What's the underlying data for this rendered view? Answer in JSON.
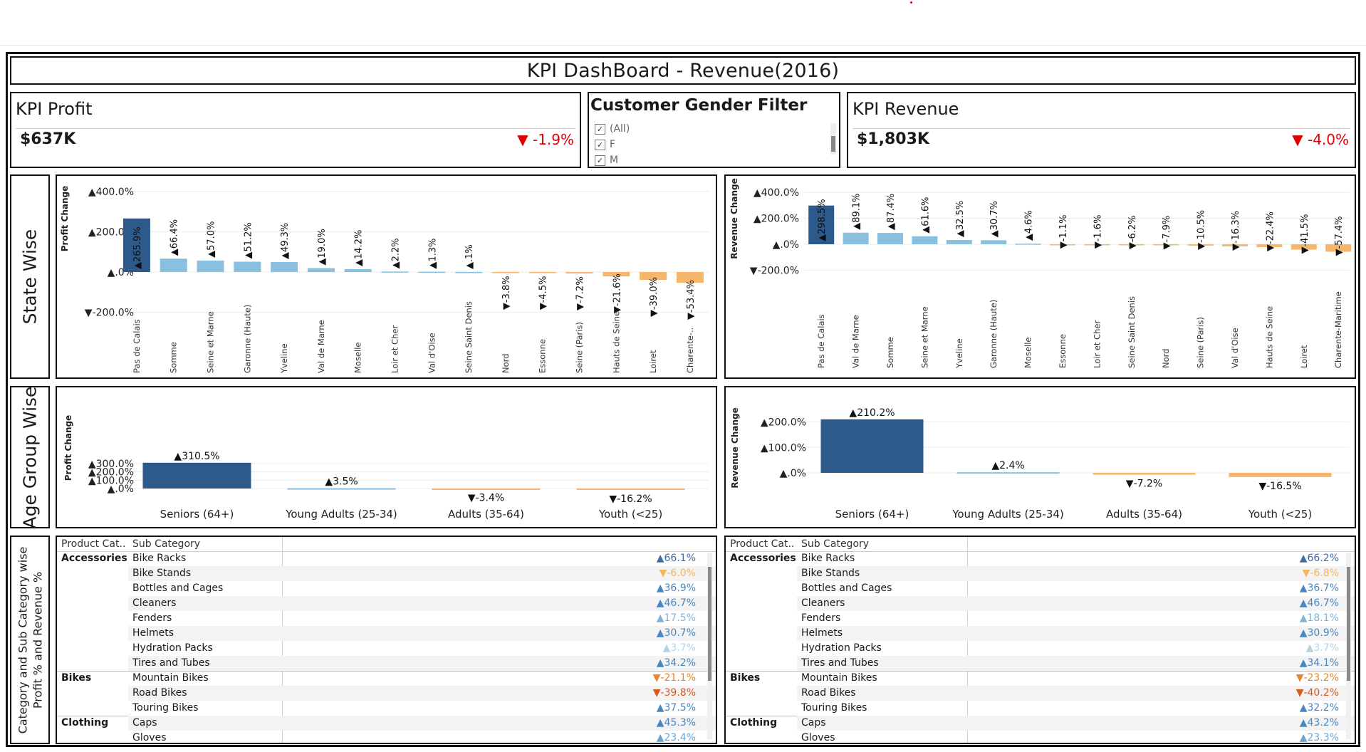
{
  "dashboard": {
    "title": "KPI DashBoard - Revenue(2016)"
  },
  "kpi_profit": {
    "title": "KPI Profit",
    "value": "$637K",
    "change": "▼ -1.9%"
  },
  "kpi_revenue": {
    "title": "KPI Revenue",
    "value": "$1,803K",
    "change": "▼ -4.0%"
  },
  "gender_filter": {
    "title": "Customer Gender Filter",
    "options": [
      {
        "label": "(All)",
        "checked": true
      },
      {
        "label": "F",
        "checked": true
      },
      {
        "label": "M",
        "checked": true
      }
    ]
  },
  "sections": {
    "state": "State Wise",
    "age": "Age Group Wise",
    "category_line1": "Category and Sub Category wise",
    "category_line2": "Profit % and Revenue %"
  },
  "colors": {
    "dark_blue": "#2c5a8a",
    "light_blue": "#89bfdf",
    "orange": "#f7b76a",
    "red": "#e00000"
  },
  "chart_data": [
    {
      "type": "bar",
      "ylabel": "Profit Change",
      "yticks": [
        "▲400.0%",
        "▲200.0%",
        "▲.0%",
        "▼-200.0%"
      ],
      "ylim": [
        -200,
        400
      ],
      "categories": [
        "Pas de Calais",
        "Somme",
        "Seine et Marne",
        "Garonne (Haute)",
        "Yveline",
        "Val de Marne",
        "Moselle",
        "Loir et Cher",
        "Val d'Oise",
        "Seine Saint Denis",
        "Nord",
        "Essonne",
        "Seine (Paris)",
        "Hauts de Seine",
        "Loiret",
        "Charente-.."
      ],
      "values": [
        265.9,
        66.4,
        57.0,
        51.2,
        49.3,
        19.0,
        14.2,
        2.2,
        1.3,
        0.1,
        -3.8,
        -4.5,
        -7.2,
        -21.6,
        -39.0,
        -53.4
      ],
      "labels": [
        "▲265.9%",
        "▲66.4%",
        "▲57.0%",
        "▲51.2%",
        "▲49.3%",
        "▲19.0%",
        "▲14.2%",
        "▲2.2%",
        "▲1.3%",
        "▲.1%",
        "▼-3.8%",
        "▼-4.5%",
        "▼-7.2%",
        "▼-21.6%",
        "▼-39.0%",
        "▼-53.4%"
      ]
    },
    {
      "type": "bar",
      "ylabel": "Revenue Change",
      "yticks": [
        "▲400.0%",
        "▲200.0%",
        "▲.0%",
        "▼-200.0%"
      ],
      "ylim": [
        -200,
        400
      ],
      "categories": [
        "Pas de Calais",
        "Val de Marne",
        "Somme",
        "Seine et Marne",
        "Yveline",
        "Garonne (Haute)",
        "Moselle",
        "Essonne",
        "Loir et Cher",
        "Seine Saint Denis",
        "Nord",
        "Seine (Paris)",
        "Val d'Oise",
        "Hauts de Seine",
        "Loiret",
        "Charente-Maritime"
      ],
      "values": [
        298.5,
        89.1,
        87.4,
        61.6,
        32.5,
        30.7,
        4.6,
        -1.1,
        -1.6,
        -6.2,
        -7.9,
        -10.5,
        -16.3,
        -22.4,
        -41.5,
        -57.4
      ],
      "labels": [
        "▲298.5%",
        "▲89.1%",
        "▲87.4%",
        "▲61.6%",
        "▲32.5%",
        "▲30.7%",
        "▲4.6%",
        "▼-1.1%",
        "▼-1.6%",
        "▼-6.2%",
        "▼-7.9%",
        "▼-10.5%",
        "▼-16.3%",
        "▼-22.4%",
        "▼-41.5%",
        "▼-57.4%"
      ]
    },
    {
      "type": "bar",
      "ylabel": "Profit Change",
      "yticks": [
        "▲300.0%",
        "▲200.0%",
        "▲100.0%",
        "▲.0%"
      ],
      "ylim": [
        0,
        300
      ],
      "categories": [
        "Seniors (64+)",
        "Young Adults (25-34)",
        "Adults (35-64)",
        "Youth (<25)"
      ],
      "values": [
        310.5,
        3.5,
        -3.4,
        -16.2
      ],
      "labels": [
        "▲310.5%",
        "▲3.5%",
        "▼-3.4%",
        "▼-16.2%"
      ]
    },
    {
      "type": "bar",
      "ylabel": "Revenue Change",
      "yticks": [
        "▲200.0%",
        "▲100.0%",
        "▲.0%"
      ],
      "ylim": [
        0,
        200
      ],
      "categories": [
        "Seniors (64+)",
        "Young Adults (25-34)",
        "Adults (35-64)",
        "Youth (<25)"
      ],
      "values": [
        210.2,
        2.4,
        -7.2,
        -16.5
      ],
      "labels": [
        "▲210.2%",
        "▲2.4%",
        "▼-7.2%",
        "▼-16.5%"
      ]
    }
  ],
  "tables": {
    "headers": {
      "category": "Product Cat..",
      "subcategory": "Sub Category"
    },
    "profit_rows": [
      {
        "category": "Accessories",
        "sub": "Bike Racks",
        "value": "▲66.1%",
        "color": "#3a6ea5"
      },
      {
        "category": "",
        "sub": "Bike Stands",
        "value": "▼-6.0%",
        "color": "#f4b55f"
      },
      {
        "category": "",
        "sub": "Bottles and Cages",
        "value": "▲36.9%",
        "color": "#4a86c0"
      },
      {
        "category": "",
        "sub": "Cleaners",
        "value": "▲46.7%",
        "color": "#4a86c0"
      },
      {
        "category": "",
        "sub": "Fenders",
        "value": "▲17.5%",
        "color": "#7fb3d8"
      },
      {
        "category": "",
        "sub": "Helmets",
        "value": "▲30.7%",
        "color": "#4a86c0"
      },
      {
        "category": "",
        "sub": "Hydration Packs",
        "value": "▲3.7%",
        "color": "#b3d2e7"
      },
      {
        "category": "",
        "sub": "Tires and Tubes",
        "value": "▲34.2%",
        "color": "#4a86c0"
      },
      {
        "category": "Bikes",
        "sub": "Mountain Bikes",
        "value": "▼-21.1%",
        "color": "#e8862e"
      },
      {
        "category": "",
        "sub": "Road Bikes",
        "value": "▼-39.8%",
        "color": "#d9581d"
      },
      {
        "category": "",
        "sub": "Touring Bikes",
        "value": "▲37.5%",
        "color": "#4a86c0"
      },
      {
        "category": "Clothing",
        "sub": "Caps",
        "value": "▲45.3%",
        "color": "#4a86c0"
      },
      {
        "category": "",
        "sub": "Gloves",
        "value": "▲23.4%",
        "color": "#6aa5d2"
      }
    ],
    "revenue_rows": [
      {
        "category": "Accessories",
        "sub": "Bike Racks",
        "value": "▲66.2%",
        "color": "#3a6ea5"
      },
      {
        "category": "",
        "sub": "Bike Stands",
        "value": "▼-6.8%",
        "color": "#f4b55f"
      },
      {
        "category": "",
        "sub": "Bottles and Cages",
        "value": "▲36.7%",
        "color": "#4a86c0"
      },
      {
        "category": "",
        "sub": "Cleaners",
        "value": "▲46.7%",
        "color": "#4a86c0"
      },
      {
        "category": "",
        "sub": "Fenders",
        "value": "▲18.1%",
        "color": "#7fb3d8"
      },
      {
        "category": "",
        "sub": "Helmets",
        "value": "▲30.9%",
        "color": "#4a86c0"
      },
      {
        "category": "",
        "sub": "Hydration Packs",
        "value": "▲3.7%",
        "color": "#b3d2e7"
      },
      {
        "category": "",
        "sub": "Tires and Tubes",
        "value": "▲34.1%",
        "color": "#4a86c0"
      },
      {
        "category": "Bikes",
        "sub": "Mountain Bikes",
        "value": "▼-23.2%",
        "color": "#e8862e"
      },
      {
        "category": "",
        "sub": "Road Bikes",
        "value": "▼-40.2%",
        "color": "#d9581d"
      },
      {
        "category": "",
        "sub": "Touring Bikes",
        "value": "▲32.2%",
        "color": "#4a86c0"
      },
      {
        "category": "Clothing",
        "sub": "Caps",
        "value": "▲43.2%",
        "color": "#4a86c0"
      },
      {
        "category": "",
        "sub": "Gloves",
        "value": "▲23.3%",
        "color": "#6aa5d2"
      }
    ]
  }
}
